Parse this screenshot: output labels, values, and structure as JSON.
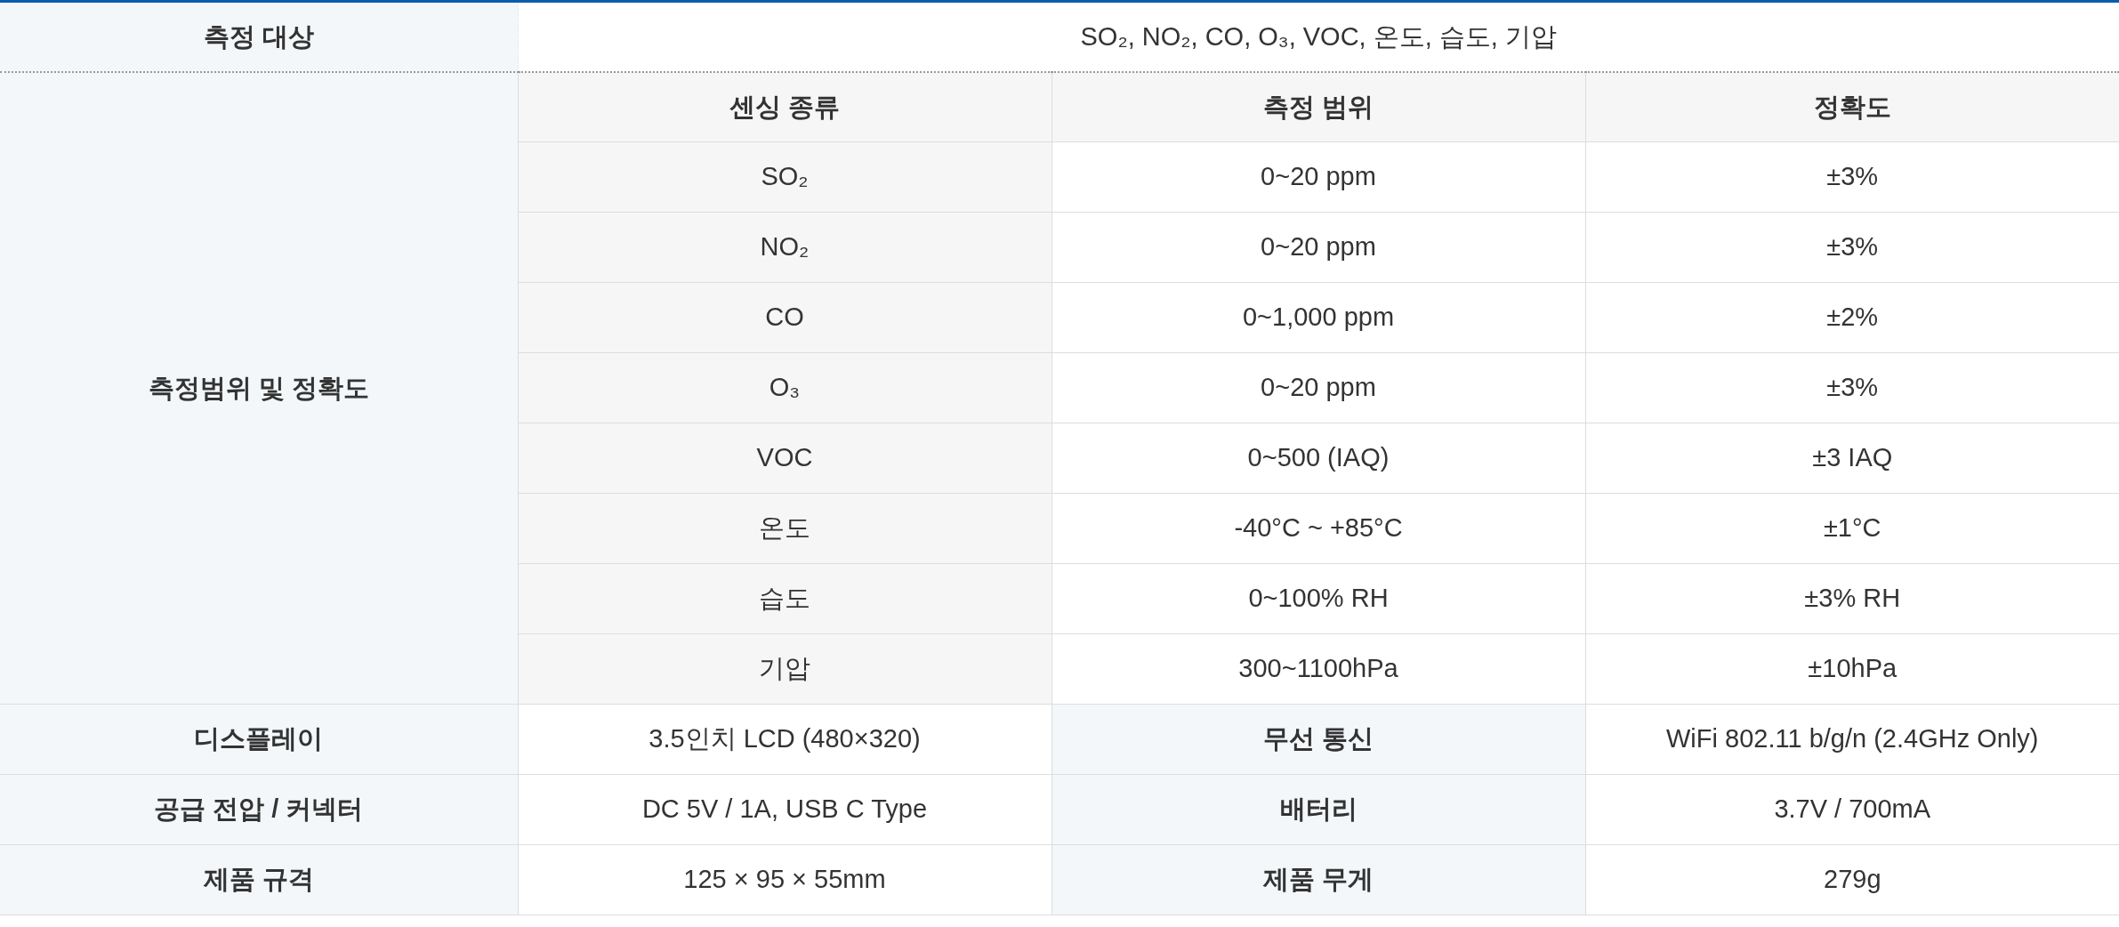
{
  "target": {
    "label": "측정 대상",
    "value": "SO₂, NO₂, CO, O₃, VOC, 온도, 습도, 기압"
  },
  "range_table": {
    "label": "측정범위 및 정확도",
    "columns": [
      "센싱 종류",
      "측정 범위",
      "정확도"
    ],
    "rows": [
      [
        "SO₂",
        "0~20 ppm",
        "±3%"
      ],
      [
        "NO₂",
        "0~20 ppm",
        "±3%"
      ],
      [
        "CO",
        "0~1,000 ppm",
        "±2%"
      ],
      [
        "O₃",
        "0~20 ppm",
        "±3%"
      ],
      [
        "VOC",
        "0~500 (IAQ)",
        "±3 IAQ"
      ],
      [
        "온도",
        "-40°C ~ +85°C",
        "±1°C"
      ],
      [
        "습도",
        "0~100% RH",
        "±3% RH"
      ],
      [
        "기압",
        "300~1100hPa",
        "±10hPa"
      ]
    ]
  },
  "specs": [
    {
      "label": "디스플레이",
      "value": "3.5인치 LCD (480×320)",
      "label_2": "무선 통신",
      "value_2": "WiFi 802.11 b/g/n (2.4GHz Only)"
    },
    {
      "label": "공급 전압 / 커넥터",
      "value": "DC 5V / 1A, USB C Type",
      "label_2": "배터리",
      "value_2": "3.7V / 700mA"
    },
    {
      "label": "제품 규격",
      "value": "125 × 95 × 55mm",
      "label_2": "제품 무게",
      "value_2": "279g"
    }
  ]
}
